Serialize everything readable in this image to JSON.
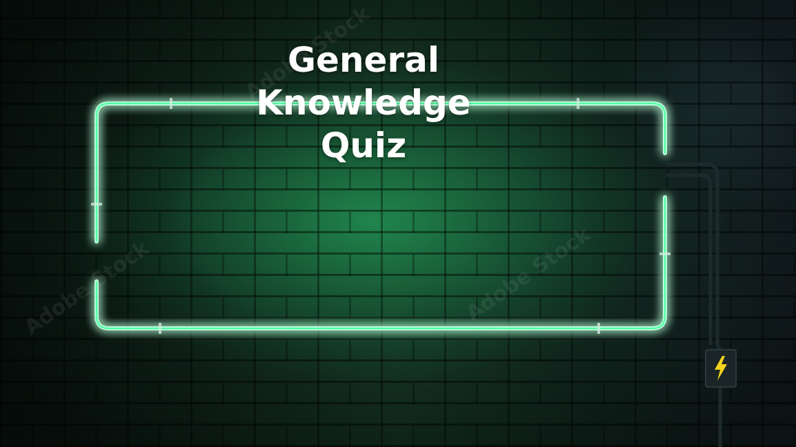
{
  "title": {
    "line1": "General",
    "line2": "Knowledge",
    "line3": "Quiz"
  },
  "colors": {
    "neon": "#3dff9a",
    "neon_glow": "#19e07a",
    "text": "#ffffff",
    "bolt": "#f2d21c"
  },
  "icons": [
    "neon-frame",
    "power-box-icon",
    "lightning-bolt-icon"
  ]
}
